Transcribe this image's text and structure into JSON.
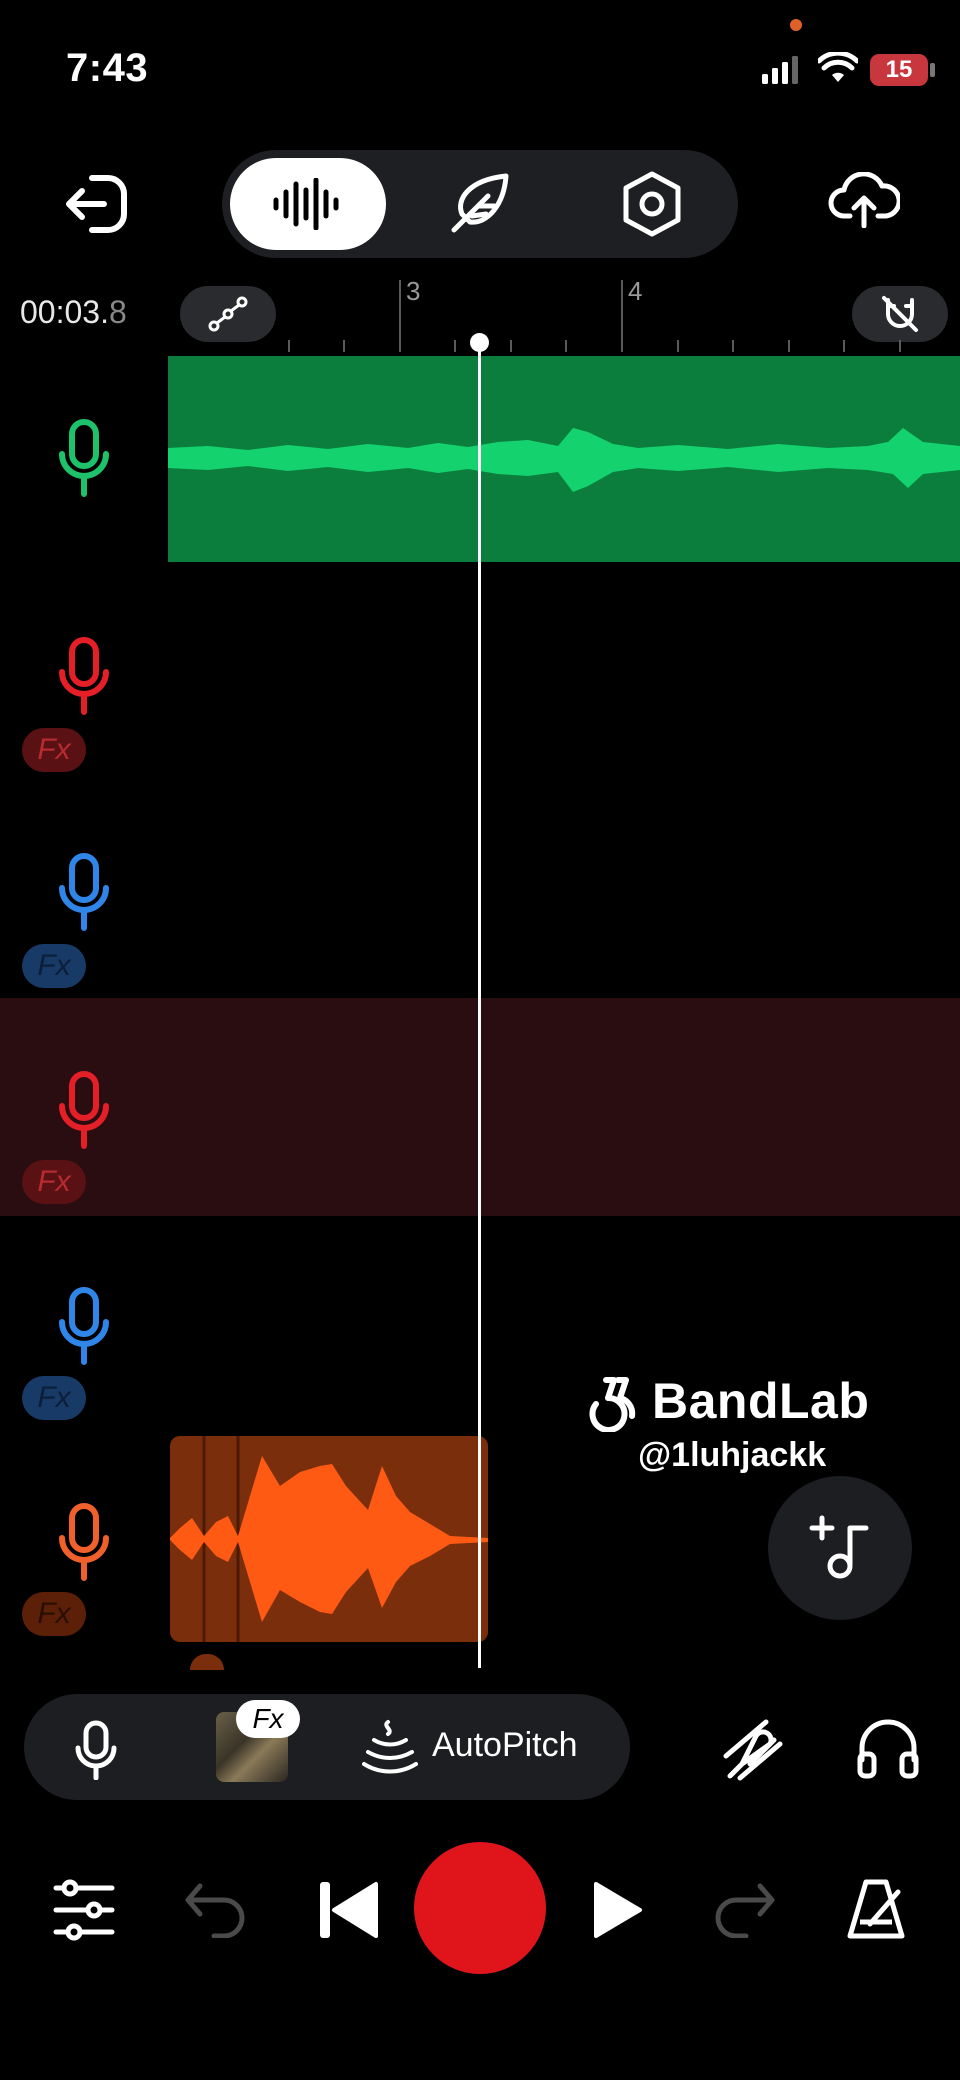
{
  "status_bar": {
    "time": "7:43",
    "battery": "15"
  },
  "timeline": {
    "timecode_main": "00:03.",
    "timecode_frac": "8",
    "ruler_labels": [
      "3",
      "4"
    ]
  },
  "watermark": {
    "brand": "BandLab",
    "handle": "@1luhjackk"
  },
  "toolbar": {
    "fx_label": "Fx",
    "autopitch_label": "AutoPitch"
  },
  "tracks": [
    {
      "color": "#1ec26b",
      "fx": ""
    },
    {
      "color": "#e41f27",
      "fx": "Fx"
    },
    {
      "color": "#2f86e8",
      "fx": "Fx"
    },
    {
      "color": "#e41f27",
      "fx": "Fx"
    },
    {
      "color": "#2f86e8",
      "fx": "Fx"
    },
    {
      "color": "#f0602a",
      "fx": "Fx"
    }
  ],
  "colors": {
    "green_region": "#0b7e3e",
    "green_wave": "#14d36e",
    "orange_region": "#7a2e0c",
    "orange_wave": "#ff5a14",
    "selected_track_bg": "#2a0d10",
    "record": "#e0141b"
  }
}
